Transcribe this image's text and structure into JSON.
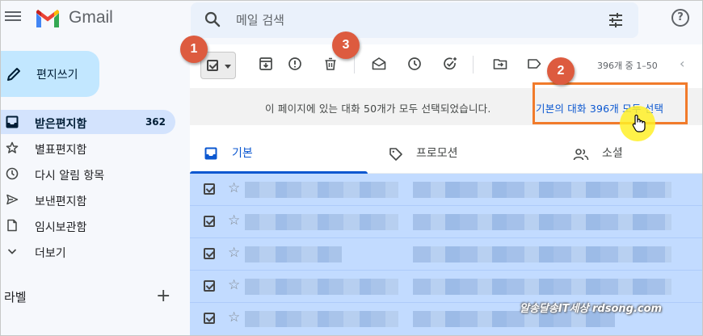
{
  "app": {
    "name": "Gmail"
  },
  "search": {
    "placeholder": "메일 검색"
  },
  "sidebar": {
    "compose_label": "편지쓰기",
    "items": [
      {
        "label": "받은편지함",
        "count": "362",
        "icon": "inbox-icon",
        "active": true
      },
      {
        "label": "별표편지함",
        "icon": "star-icon"
      },
      {
        "label": "다시 알림 항목",
        "icon": "clock-icon"
      },
      {
        "label": "보낸편지함",
        "icon": "send-icon"
      },
      {
        "label": "임시보관함",
        "icon": "draft-icon"
      },
      {
        "label": "더보기",
        "icon": "chevron-down-icon"
      }
    ],
    "labels_title": "라벨"
  },
  "toolbar": {
    "pager_text": "396개 중 1–50",
    "icons": [
      "archive-icon",
      "report-spam-icon",
      "delete-icon",
      "mark-read-icon",
      "snooze-icon",
      "add-task-icon",
      "move-to-icon",
      "label-icon"
    ]
  },
  "banner": {
    "message": "이 페이지에 있는 대화 50개가 모두 선택되었습니다.",
    "select_all_link": "기본의 대화 396개 모두 선택"
  },
  "tabs": [
    {
      "label": "기본",
      "icon": "inbox-icon",
      "active": true
    },
    {
      "label": "프로모션",
      "icon": "tag-icon"
    },
    {
      "label": "소셜",
      "icon": "people-icon"
    }
  ],
  "callouts": [
    "1",
    "2",
    "3"
  ],
  "watermark": "알송달송IT세상 rdsong.com",
  "colors": {
    "accent": "#0b57d0",
    "selected_row": "#c2dbff",
    "callout": "#dd5b3f",
    "highlight_box": "#f17b2b"
  }
}
